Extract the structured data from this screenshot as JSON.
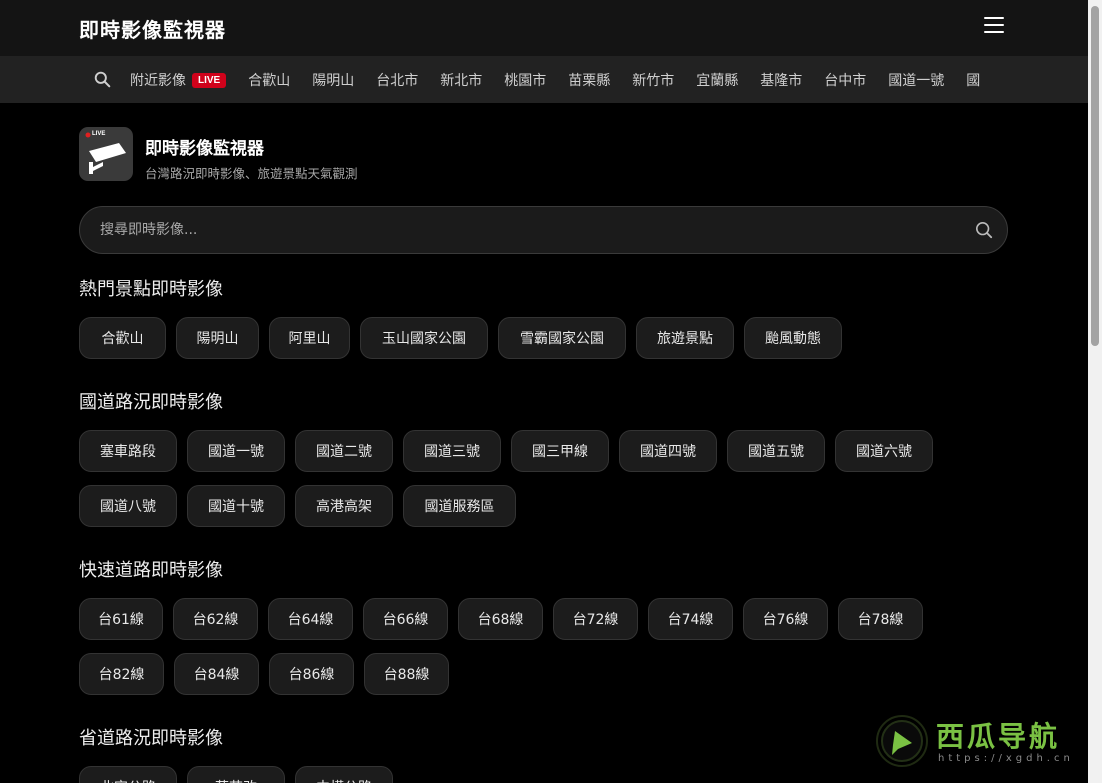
{
  "header": {
    "title": "即時影像監視器"
  },
  "nav": {
    "live_badge": "LIVE",
    "items": [
      "附近影像",
      "合歡山",
      "陽明山",
      "台北市",
      "新北市",
      "桃園市",
      "苗栗縣",
      "新竹市",
      "宜蘭縣",
      "基隆市",
      "台中市",
      "國道一號",
      "國"
    ]
  },
  "brand": {
    "name": "即時影像監視器",
    "subtitle": "台灣路況即時影像、旅遊景點天氣觀測",
    "logo_badge": "LIVE"
  },
  "search": {
    "placeholder": "搜尋即時影像..."
  },
  "sections": [
    {
      "title": "熱門景點即時影像",
      "chips": [
        "合歡山",
        "陽明山",
        "阿里山",
        "玉山國家公園",
        "雪霸國家公園",
        "旅遊景點",
        "颱風動態"
      ]
    },
    {
      "title": "國道路況即時影像",
      "chips": [
        "塞車路段",
        "國道一號",
        "國道二號",
        "國道三號",
        "國三甲線",
        "國道四號",
        "國道五號",
        "國道六號",
        "國道八號",
        "國道十號",
        "高港高架",
        "國道服務區"
      ]
    },
    {
      "title": "快速道路即時影像",
      "chips": [
        "台61線",
        "台62線",
        "台64線",
        "台66線",
        "台68線",
        "台72線",
        "台74線",
        "台76線",
        "台78線",
        "台82線",
        "台84線",
        "台86線",
        "台88線"
      ]
    },
    {
      "title": "省道路況即時影像",
      "chips": [
        "北宜公路",
        "蘇花改",
        "中橫公路"
      ]
    }
  ],
  "watermark": {
    "title": "西瓜导航",
    "url": "https://xgdh.cn"
  },
  "colors": {
    "background": "#000000",
    "live_red": "#d0021b",
    "watermark_green": "#7ac143"
  }
}
